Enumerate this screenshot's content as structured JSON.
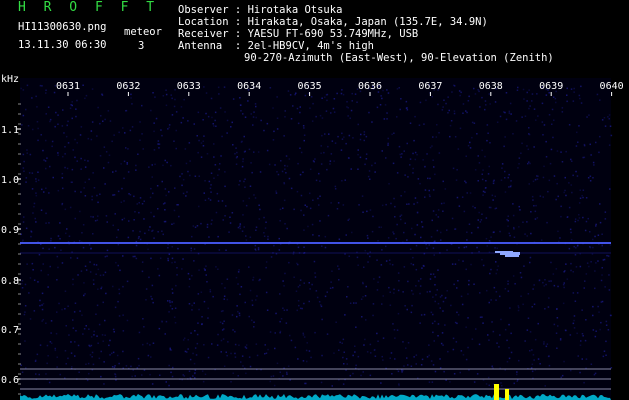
{
  "header": {
    "app_title": "H R O F F T",
    "filename": "HI11300630.png",
    "datetime": "13.11.30 06:30",
    "meteor_label": "meteor",
    "meteor_count": "3"
  },
  "station_info": [
    {
      "label": "Observer ",
      "value": "Hirotaka Otsuka"
    },
    {
      "label": "Location ",
      "value": "Hirakata, Osaka, Japan (135.7E, 34.9N)"
    },
    {
      "label": "Receiver ",
      "value": "YAESU FT-690 53.749MHz, USB"
    },
    {
      "label": "Antenna  ",
      "value": "2el-HB9CV, 4m's high"
    },
    {
      "label": "",
      "value": "90-270-Azimuth (East-West), 90-Elevation (Zenith)"
    }
  ],
  "axes": {
    "y_unit": "kHz",
    "time_labels": [
      "0631",
      "0632",
      "0633",
      "0634",
      "0635",
      "0636",
      "0637",
      "0638",
      "0639",
      "0640"
    ],
    "freq_labels": [
      "1.1",
      "1.0",
      "0.9",
      "0.8",
      "0.7",
      "0.6"
    ]
  },
  "colors": {
    "background": "#000010",
    "noise": "#1a1a8a",
    "carrier": "#4a5cff",
    "title_green": "#33dd44",
    "tick_label": "#ffffff",
    "bottom_trace": "#00bbdd",
    "meteor_yellow": "#ffff00"
  }
}
